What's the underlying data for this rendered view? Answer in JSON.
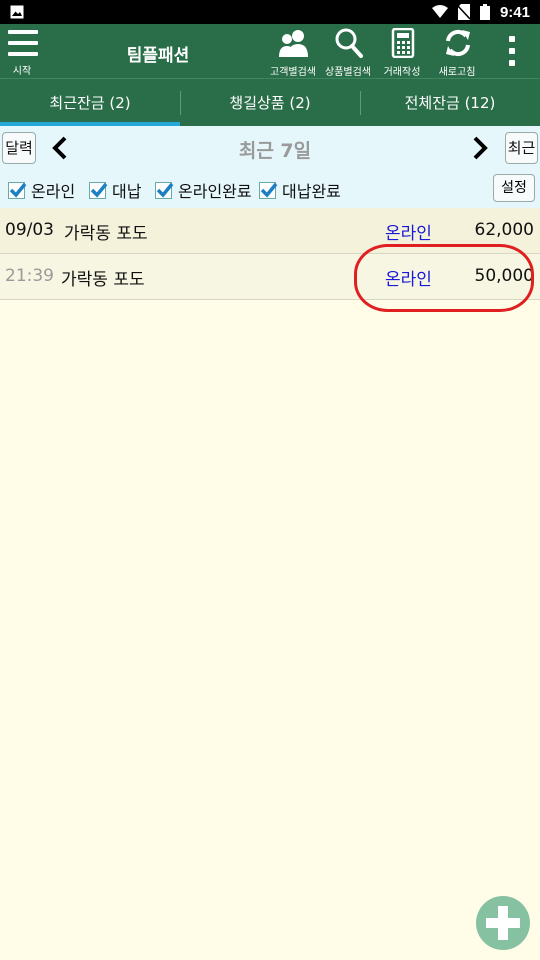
{
  "status_bar": {
    "time": "9:41"
  },
  "app_bar": {
    "menu_caption": "시작",
    "title": "팀플패션",
    "tools": [
      {
        "icon": "people-icon",
        "label": "고객별검색"
      },
      {
        "icon": "search-icon",
        "label": "상품별검색"
      },
      {
        "icon": "calculator-icon",
        "label": "거래작성"
      },
      {
        "icon": "refresh-icon",
        "label": "새로고침"
      }
    ]
  },
  "tabs": [
    {
      "label": "최근잔금 (2)",
      "active": true
    },
    {
      "label": "챙길상품 (2)",
      "active": false
    },
    {
      "label": "전체잔금 (12)",
      "active": false
    }
  ],
  "date_bar": {
    "calendar_button": "달력",
    "range_label": "최근 7일",
    "recent_button": "최근"
  },
  "filters": {
    "options": [
      {
        "label": "온라인",
        "checked": true
      },
      {
        "label": "대납",
        "checked": true
      },
      {
        "label": "온라인완료",
        "checked": true
      },
      {
        "label": "대납완료",
        "checked": true
      }
    ],
    "settings_button": "설정"
  },
  "rows": [
    {
      "date": "09/03",
      "name": "가락동 포도",
      "status": "온라인",
      "amount": "62,000"
    },
    {
      "date": "21:39",
      "name": "가락동 포도",
      "status": "온라인",
      "amount": "50,000"
    }
  ],
  "colors": {
    "app_bar": "#2a6e49",
    "tab_indicator": "#24a8d8",
    "filter_bg": "#e5f7fb",
    "list_bg": "#fffde8",
    "status_text": "#1a1ad6",
    "highlight": "#e02020",
    "fab": "#86c2a2"
  }
}
